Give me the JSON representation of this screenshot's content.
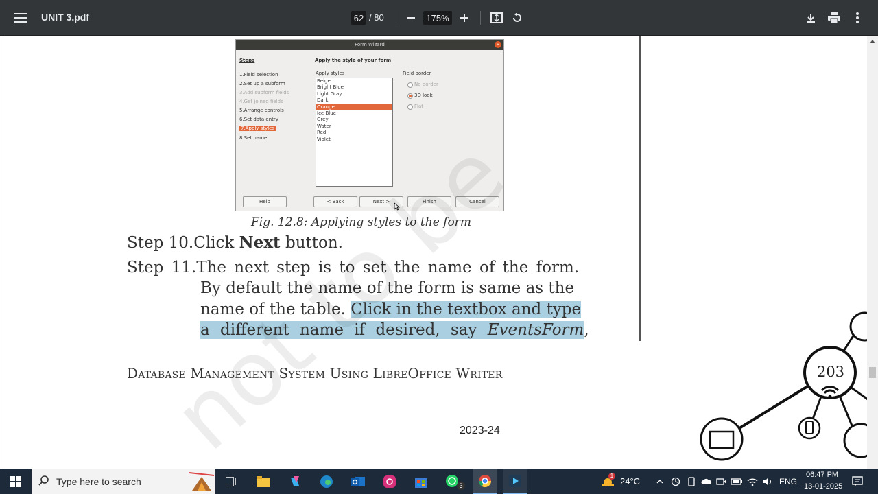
{
  "toolbar": {
    "title": "UNIT 3.pdf",
    "page_current": "62",
    "page_total": "/ 80",
    "zoom": "175%",
    "icons": [
      "menu-icon",
      "zoom-out-icon",
      "zoom-in-icon",
      "fit-page-icon",
      "rotate-icon",
      "download-icon",
      "print-icon",
      "more-icon"
    ]
  },
  "figure": {
    "window_title": "Form Wizard",
    "steps_header": "Steps",
    "heading": "Apply the style of your form",
    "styles_label": "Apply styles",
    "border_label": "Field border",
    "steps": [
      "1.Field selection",
      "2.Set up a subform",
      "3.Add subform fields",
      "4.Get joined fields",
      "5.Arrange controls",
      "6.Set data entry",
      "7.Apply styles",
      "8.Set name"
    ],
    "styles": [
      "Beige",
      "Bright Blue",
      "Light Gray",
      "Dark",
      "Orange",
      "Ice Blue",
      "Grey",
      "Water",
      "Red",
      "Violet"
    ],
    "selected_style": "Orange",
    "border_options": [
      "No border",
      "3D look",
      "Flat"
    ],
    "selected_border": "3D look",
    "buttons": [
      "Help",
      "< Back",
      "Next >",
      "Finish",
      "Cancel"
    ]
  },
  "caption": "Fig. 12.8: Applying styles to the form",
  "step10": {
    "prefix": "Step 10.Click ",
    "bold": "Next",
    "suffix": " button."
  },
  "step11": {
    "line1": "Step 11.The next step is to set the name of the form.",
    "line2": "By default the name of the form is same as the",
    "line3_plain": "name of the table. ",
    "line3_hl": "Click in the textbox and type",
    "line4_hl": "a different name if desired, say ",
    "line4_italic": "EventsForm",
    "line4_end": ","
  },
  "footer": "Database Management System Using LibreOffice Writer",
  "year": "2023-24",
  "watermark": "not to be",
  "network_badge": "203",
  "taskbar": {
    "search_placeholder": "Type here to search",
    "whatsapp_badge": "3",
    "weather_badge": "1",
    "temperature": "24°C",
    "language": "ENG",
    "time": "06:47 PM",
    "date": "13-01-2025"
  }
}
